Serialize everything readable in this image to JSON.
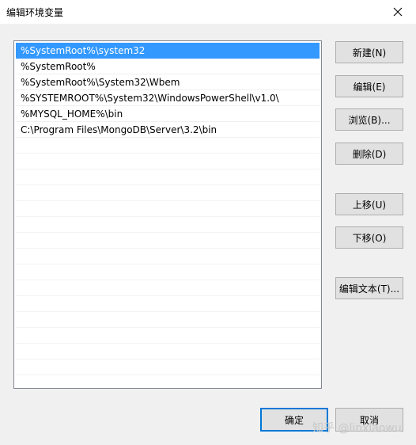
{
  "window": {
    "title": "编辑环境变量"
  },
  "list": {
    "items": [
      "%SystemRoot%\\system32",
      "%SystemRoot%",
      "%SystemRoot%\\System32\\Wbem",
      "%SYSTEMROOT%\\System32\\WindowsPowerShell\\v1.0\\",
      "%MYSQL_HOME%\\bin",
      "C:\\Program Files\\MongoDB\\Server\\3.2\\bin"
    ],
    "selected_index": 0
  },
  "buttons": {
    "new": "新建(N)",
    "edit": "编辑(E)",
    "browse": "浏览(B)...",
    "delete": "删除(D)",
    "move_up": "上移(U)",
    "move_down": "下移(O)",
    "edit_text": "编辑文本(T)...",
    "ok": "确定",
    "cancel": "取消"
  },
  "watermark": "知乎 @linxiaowu",
  "colors": {
    "selection": "#3399ff",
    "default_border": "#0078d7"
  },
  "icons": {
    "close": "close-icon"
  }
}
